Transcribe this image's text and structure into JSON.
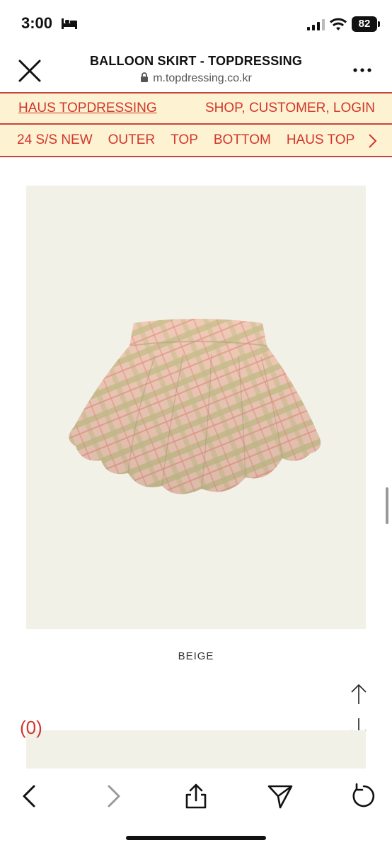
{
  "status_bar": {
    "time": "3:00",
    "battery": "82"
  },
  "browser": {
    "title": "BALLOON SKIRT - TOPDRESSING",
    "url": "m.topdressing.co.kr"
  },
  "site_nav": {
    "brand": "HAUS TOPDRESSING",
    "links": "SHOP, CUSTOMER, LOGIN",
    "categories": [
      "24 S/S NEW",
      "OUTER",
      "TOP",
      "BOTTOM",
      "HAUS TOP"
    ]
  },
  "product": {
    "color_caption": "BEIGE",
    "cart_count": "(0)"
  },
  "icons": {
    "close": "close-icon",
    "more": "more-icon",
    "lock": "lock-icon",
    "back": "chevron-left-icon",
    "forward": "chevron-right-icon",
    "share": "share-icon",
    "send": "send-icon",
    "reload": "reload-icon",
    "scroll_up": "arrow-up-icon",
    "scroll_down": "arrow-down-icon"
  },
  "colors": {
    "accent": "#d2362c",
    "nav_bg": "#fdf2d1",
    "image_bg": "#f2f1e8"
  }
}
